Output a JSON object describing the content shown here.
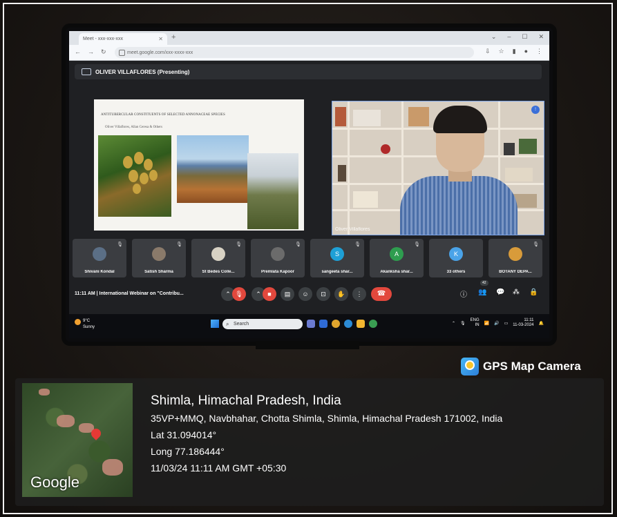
{
  "browser": {
    "tab_title": "Meet - xxx-xxx-xxx",
    "new_tab": "+",
    "address": "meet.google.com/xxx-xxxx-xxx"
  },
  "meet": {
    "presenting_banner": "OLIVER VILLAFLORES (Presenting)",
    "slide": {
      "title": "ANTITUBERCULAR CONSTITUENTS OF SELECTED ANNONACEAE SPECIES",
      "subtitle": "Oliver Villaflores, Allan Ceresa & Others"
    },
    "speaker_name": "Oliver Villaflores",
    "participants": [
      {
        "name": "Shivani Kondal",
        "initial": "",
        "color": "#5b6f86"
      },
      {
        "name": "Satish Sharma",
        "initial": "",
        "color": "#8a7a6a"
      },
      {
        "name": "St Bedes Colle...",
        "initial": "",
        "color": "#d8d2c4"
      },
      {
        "name": "Premlata Kapoor",
        "initial": "",
        "color": "#6b6b6b"
      },
      {
        "name": "sangeeta shar...",
        "initial": "S",
        "color": "#1ea0d6"
      },
      {
        "name": "Akanksha shar...",
        "initial": "A",
        "color": "#2e9d4f"
      },
      {
        "name": "33 others",
        "initial": "K",
        "color": "#4aa3e8"
      },
      {
        "name": "BOTANY DEPA...",
        "initial": "",
        "color": "#d89b3a"
      }
    ],
    "meeting_info": "11:11 AM  |  International Webinar on \"Contribu...",
    "people_count": "42"
  },
  "taskbar": {
    "temperature": "9°C",
    "weather": "Sunny",
    "search_placeholder": "Search",
    "lang_1": "ENG",
    "lang_2": "IN",
    "time": "11:11",
    "date": "11-03-2024"
  },
  "gps": {
    "brand": "GPS Map Camera",
    "city": "Shimla, Himachal Pradesh, India",
    "address": "35VP+MMQ, Navbhahar, Chotta Shimla, Shimla, Himachal Pradesh 171002, India",
    "lat": "Lat 31.094014°",
    "long": "Long 77.186444°",
    "datetime": "11/03/24 11:11 AM GMT +05:30",
    "map_label": "Google"
  },
  "colors": {
    "end_call": "#e2483d",
    "accent_blue": "#3a6fd8"
  }
}
